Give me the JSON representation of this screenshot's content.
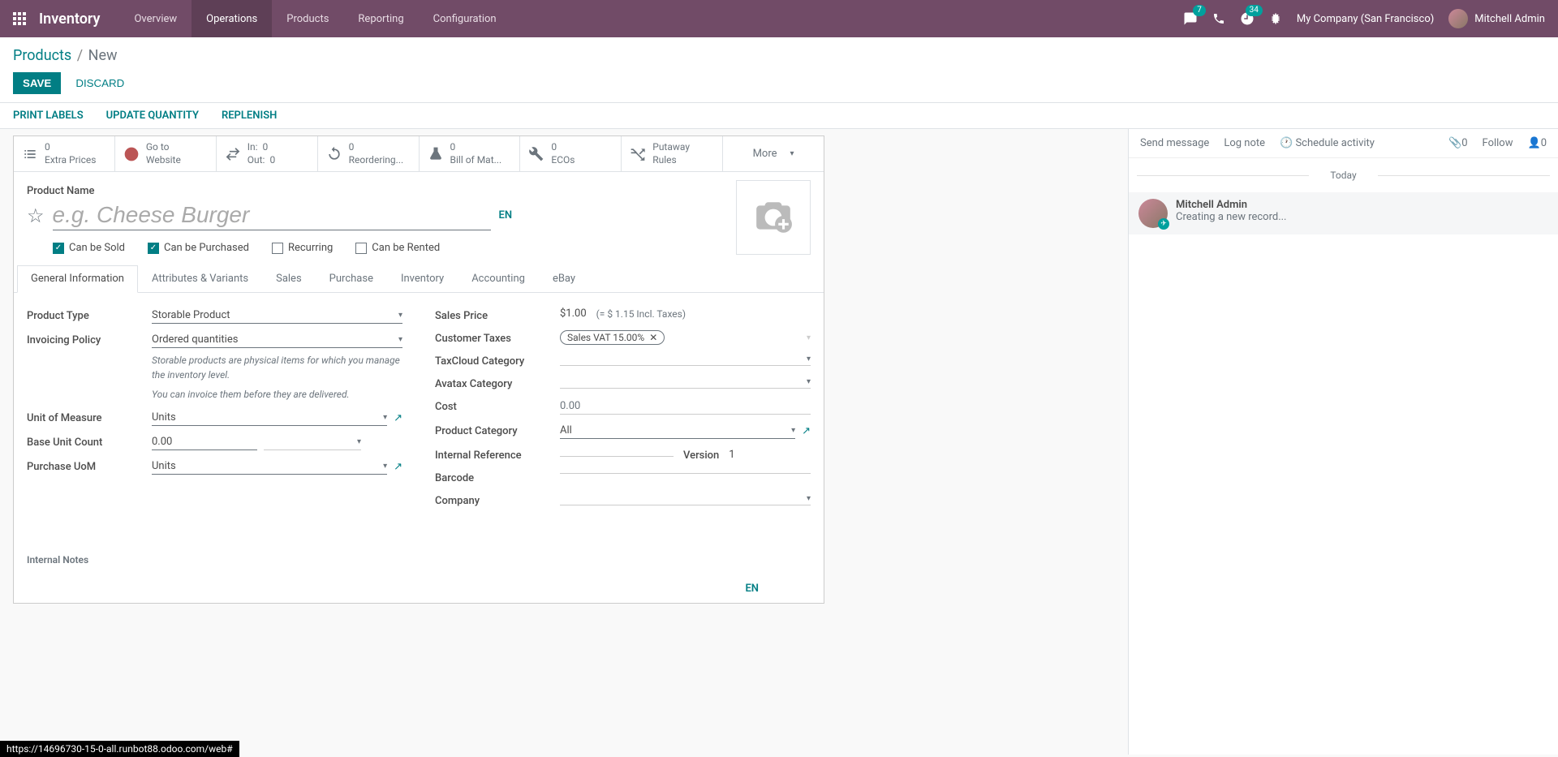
{
  "nav": {
    "brand": "Inventory",
    "items": [
      "Overview",
      "Operations",
      "Products",
      "Reporting",
      "Configuration"
    ],
    "active_index": 1,
    "msg_badge": "7",
    "clock_badge": "34",
    "company": "My Company (San Francisco)",
    "user": "Mitchell Admin"
  },
  "breadcrumb": {
    "parent": "Products",
    "current": "New"
  },
  "buttons": {
    "save": "SAVE",
    "discard": "DISCARD"
  },
  "actions": {
    "print": "PRINT LABELS",
    "update_qty": "UPDATE QUANTITY",
    "replenish": "REPLENISH"
  },
  "stats": {
    "extra_prices": {
      "val": "0",
      "label": "Extra Prices"
    },
    "website": {
      "label1": "Go to",
      "label2": "Website"
    },
    "in_out": {
      "in_lbl": "In:",
      "in_val": "0",
      "out_lbl": "Out:",
      "out_val": "0"
    },
    "reordering": {
      "val": "0",
      "label": "Reordering..."
    },
    "bom": {
      "val": "0",
      "label": "Bill of Mat..."
    },
    "ecos": {
      "val": "0",
      "label": "ECOs"
    },
    "putaway": {
      "label1": "Putaway",
      "label2": "Rules"
    },
    "more": "More"
  },
  "title": {
    "label": "Product Name",
    "placeholder": "e.g. Cheese Burger",
    "lang": "EN"
  },
  "checks": {
    "sold": "Can be Sold",
    "purchased": "Can be Purchased",
    "recurring": "Recurring",
    "rented": "Can be Rented"
  },
  "tabs": [
    "General Information",
    "Attributes & Variants",
    "Sales",
    "Purchase",
    "Inventory",
    "Accounting",
    "eBay"
  ],
  "fields": {
    "product_type": {
      "label": "Product Type",
      "value": "Storable Product"
    },
    "invoicing_policy": {
      "label": "Invoicing Policy",
      "value": "Ordered quantities"
    },
    "help1": "Storable products are physical items for which you manage the inventory level.",
    "help2": "You can invoice them before they are delivered.",
    "uom": {
      "label": "Unit of Measure",
      "value": "Units"
    },
    "base_unit": {
      "label": "Base Unit Count",
      "value": "0.00"
    },
    "purchase_uom": {
      "label": "Purchase UoM",
      "value": "Units"
    },
    "sales_price": {
      "label": "Sales Price",
      "value": "$1.00",
      "note": "(= $ 1.15 Incl. Taxes)"
    },
    "customer_taxes": {
      "label": "Customer Taxes",
      "tag": "Sales VAT 15.00%"
    },
    "taxcloud": {
      "label": "TaxCloud Category"
    },
    "avatax": {
      "label": "Avatax Category"
    },
    "cost": {
      "label": "Cost",
      "value": "0.00"
    },
    "category": {
      "label": "Product Category",
      "value": "All"
    },
    "internal_ref": {
      "label": "Internal Reference"
    },
    "version": {
      "label": "Version",
      "value": "1"
    },
    "barcode": {
      "label": "Barcode"
    },
    "company": {
      "label": "Company"
    }
  },
  "internal_notes": "Internal Notes",
  "en_bottom": "EN",
  "chatter": {
    "send": "Send message",
    "log": "Log note",
    "schedule": "Schedule activity",
    "attach_count": "0",
    "follow": "Follow",
    "follower_count": "0",
    "today": "Today",
    "msg_author": "Mitchell Admin",
    "msg_text": "Creating a new record..."
  },
  "status_url": "https://14696730-15-0-all.runbot88.odoo.com/web#"
}
